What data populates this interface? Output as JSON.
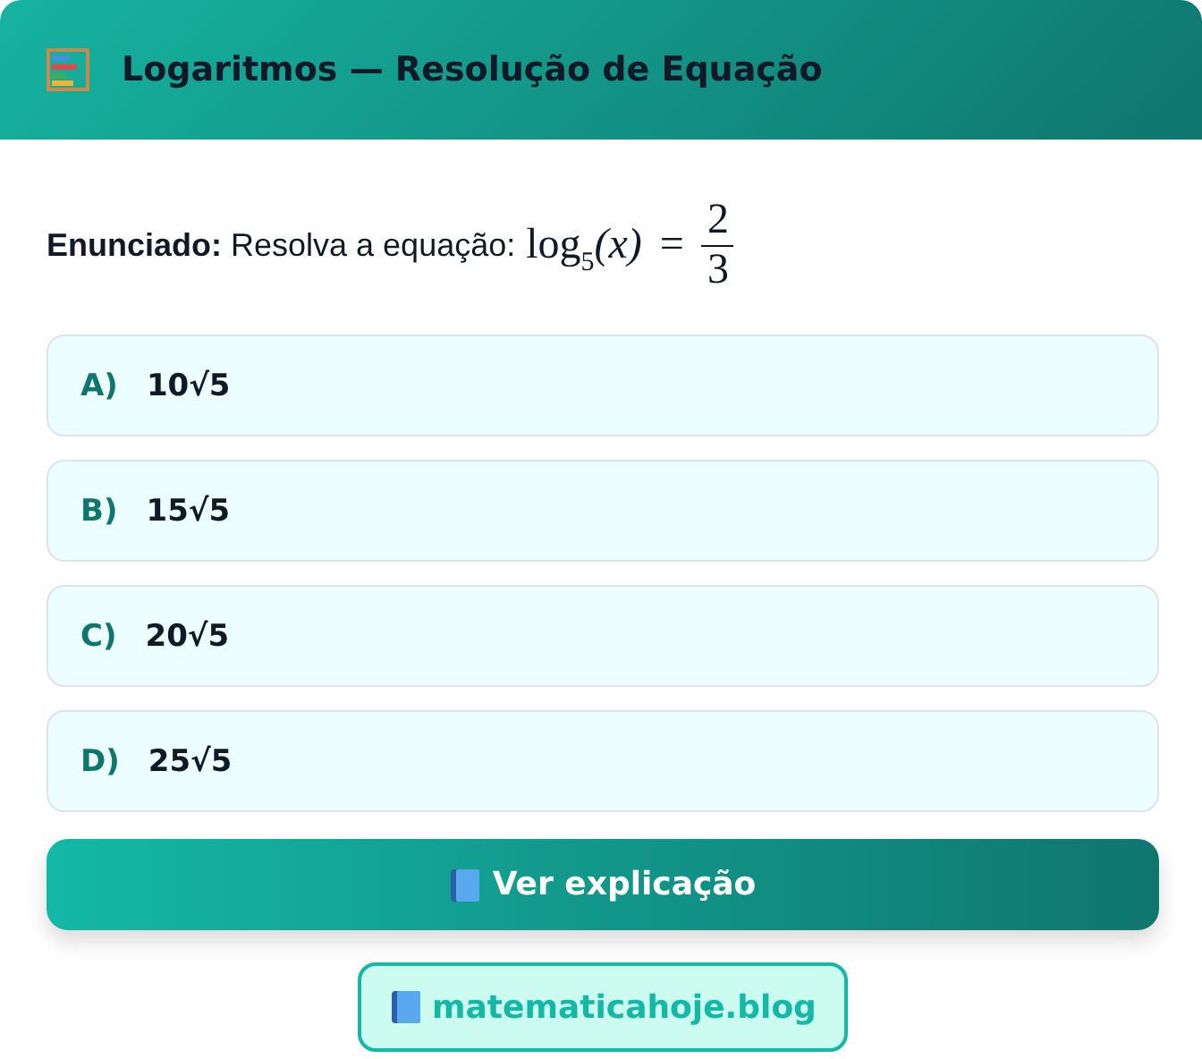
{
  "header": {
    "title": "Logaritmos — Resolução de Equação"
  },
  "statement": {
    "label": "Enunciado:",
    "text": "Resolva a equação:",
    "equation": {
      "func": "log",
      "base": "5",
      "argument": "(x)",
      "relation": "=",
      "numerator": "2",
      "denominator": "3"
    }
  },
  "options": [
    {
      "letter": "A)",
      "answer": "10√5"
    },
    {
      "letter": "B)",
      "answer": "15√5"
    },
    {
      "letter": "C)",
      "answer": "20√5"
    },
    {
      "letter": "D)",
      "answer": "25√5"
    }
  ],
  "explain_button": {
    "label": "Ver explicação"
  },
  "site_link": {
    "label": "matematicahoje.blog"
  }
}
